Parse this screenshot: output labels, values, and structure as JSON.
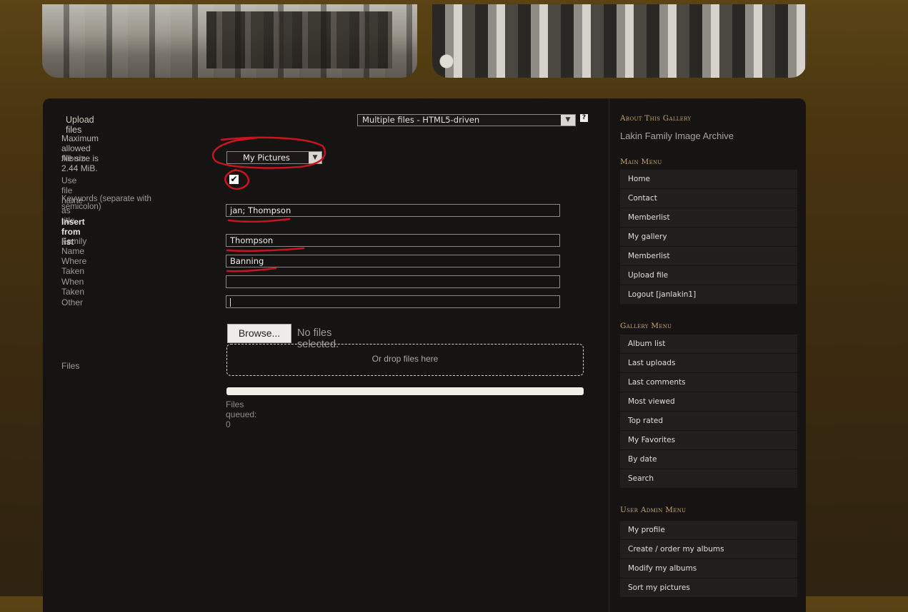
{
  "upload": {
    "title": "Upload files",
    "mode_select": "Multiple files - HTML5-driven",
    "help": "?",
    "max_size": "Maximum allowed file size is 2.44 MiB.",
    "album_label": "Album",
    "album_value": "My Pictures",
    "use_filename_label": "Use file name as title",
    "use_filename_checked": true,
    "keywords_label": "Keywords (separate with semicolon)",
    "keywords_value": "jan; Thompson",
    "insert_from_list": "Insert from list",
    "family_name_label": "Family Name",
    "family_name_value": "Thompson",
    "where_taken_label": "Where Taken",
    "where_taken_value": "Banning",
    "when_taken_label": "When Taken",
    "when_taken_value": "",
    "other_label": "Other",
    "other_value": "",
    "files_label": "Files",
    "browse_label": "Browse...",
    "no_files": "No files selected.",
    "drop_label": "Or drop files here",
    "progress": 1.0,
    "queued": "Files queued: 0"
  },
  "sidebar": {
    "about_title": "About This Gallery",
    "about_text": "Lakin Family Image Archive",
    "main_menu_title": "Main Menu",
    "main_menu": [
      "Home",
      "Contact",
      "Memberlist",
      "My gallery",
      "Memberlist",
      "Upload file",
      "Logout [janlakin1]"
    ],
    "gallery_menu_title": "Gallery Menu",
    "gallery_menu": [
      "Album list",
      "Last uploads",
      "Last comments",
      "Most viewed",
      "Top rated",
      "My Favorites",
      "By date",
      "Search"
    ],
    "user_admin_title": "User Admin Menu",
    "user_admin_menu": [
      "My profile",
      "Create / order my albums",
      "Modify my albums",
      "Sort my pictures"
    ]
  },
  "colors": {
    "panel": "#151412",
    "accent_title": "#c9a36a",
    "annotation_red": "#c8141e"
  }
}
